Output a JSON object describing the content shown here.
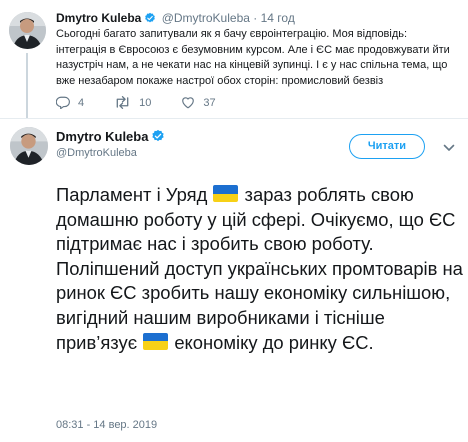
{
  "parent_tweet": {
    "author_name": "Dmytro Kuleba",
    "author_handle": "@DmytroKuleba",
    "separator": "·",
    "time": "14 год",
    "text": "Сьогодні багато запитували як я бачу євроінтеграцію. Моя відповідь: інтеграція в Євросоюз є безумовним курсом. Але і ЄС має продовжувати йти назустріч нам, а не чекати нас на кінцевій зупинці. І є у нас спільна тема, що вже незабаром покаже настрої обох сторін: промисловий безвіз",
    "actions": {
      "replies": "4",
      "retweets": "10",
      "likes": "37"
    }
  },
  "main_tweet": {
    "author_name": "Dmytro Kuleba",
    "author_handle": "@DmytroKuleba",
    "follow_label": "Читати",
    "text_part1": "Парламент і Уряд ",
    "text_part2": " зараз роблять свою домашню роботу у цій сфері. Очікуємо, що ЄС підтримає нас і зробить свою роботу. Поліпшений доступ українських промтоварів на ринок ЄС зробить нашу економіку сильнішою, вигідний нашим виробниками і тісніше прив’язує ",
    "text_part3": " економіку до ринку ЄС.",
    "timestamp": "08:31 - 14 вер. 2019"
  },
  "icons": {
    "verified": "verified-badge-icon",
    "reply": "reply-icon",
    "retweet": "retweet-icon",
    "like": "heart-icon",
    "caret": "chevron-down-icon",
    "flag": "ukraine-flag-icon"
  },
  "colors": {
    "accent": "#1da1f2",
    "text": "#14171a",
    "muted": "#657786",
    "flag_blue": "#1c6fd0",
    "flag_yellow": "#f7d117"
  }
}
